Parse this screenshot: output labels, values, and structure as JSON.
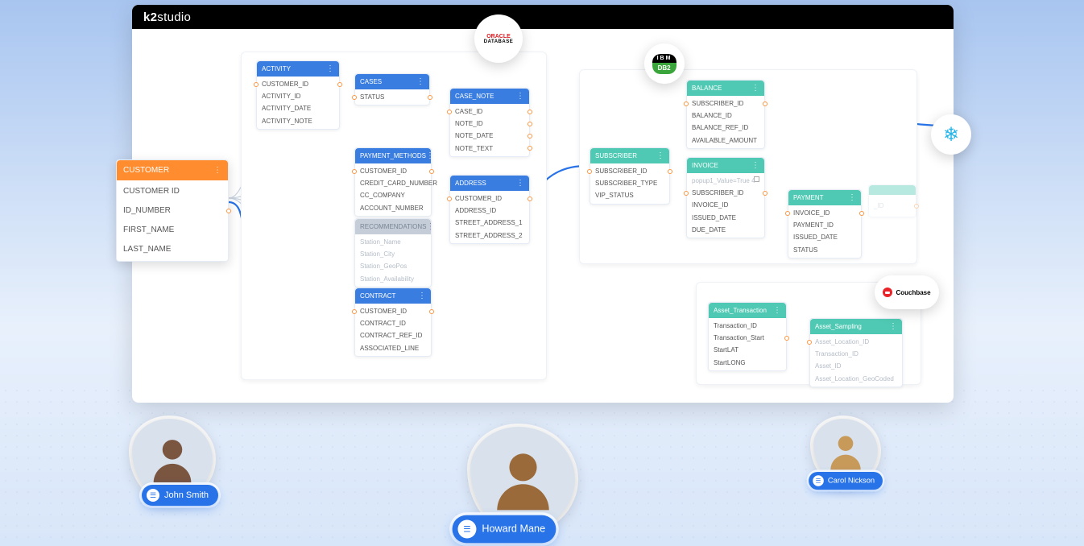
{
  "app": {
    "logo_prefix": "k2",
    "logo_suffix": "studio"
  },
  "badges": {
    "oracle": {
      "line1": "ORACLE",
      "line2": "DATABASE"
    },
    "ibm": {
      "top": "IBM",
      "bottom": "DB2"
    },
    "couchbase": "Couchbase"
  },
  "customer": {
    "title": "CUSTOMER",
    "fields": [
      "CUSTOMER ID",
      "ID_NUMBER",
      "FIRST_NAME",
      "LAST_NAME"
    ]
  },
  "oracle_panel": {
    "activity": {
      "title": "ACTIVITY",
      "fields": [
        "CUSTOMER_ID",
        "ACTIVITY_ID",
        "ACTIVITY_DATE",
        "ACTIVITY_NOTE"
      ]
    },
    "cases": {
      "title": "CASES",
      "fields": [
        "STATUS"
      ]
    },
    "case_note": {
      "title": "CASE_NOTE",
      "fields": [
        "CASE_ID",
        "NOTE_ID",
        "NOTE_DATE",
        "NOTE_TEXT"
      ]
    },
    "payment_methods": {
      "title": "PAYMENT_METHODS",
      "fields": [
        "CUSTOMER_ID",
        "CREDIT_CARD_NUMBER",
        "CC_COMPANY",
        "ACCOUNT_NUMBER"
      ]
    },
    "address": {
      "title": "ADDRESS",
      "fields": [
        "CUSTOMER_ID",
        "ADDRESS_ID",
        "STREET_ADDRESS_1",
        "STREET_ADDRESS_2"
      ]
    },
    "recommendations": {
      "title": "RECOMMENDATIONS",
      "fields": [
        "Station_Name",
        "Station_City",
        "Station_GeoPos",
        "Station_Availability"
      ]
    },
    "contract": {
      "title": "CONTRACT",
      "fields": [
        "CUSTOMER_ID",
        "CONTRACT_ID",
        "CONTRACT_REF_ID",
        "ASSOCIATED_LINE"
      ]
    }
  },
  "db2_panel": {
    "subscriber": {
      "title": "SUBSCRIBER",
      "fields": [
        "SUBSCRIBER_ID",
        "SUBSCRIBER_TYPE",
        "VIP_STATUS"
      ]
    },
    "balance": {
      "title": "BALANCE",
      "fields": [
        "SUBSCRIBER_ID",
        "BALANCE_ID",
        "BALANCE_REF_ID",
        "AVAILABLE_AMOUNT"
      ]
    },
    "invoice": {
      "title": "INVOICE",
      "fields": [
        "popup1_Value=True",
        "SUBSCRIBER_ID",
        "INVOICE_ID",
        "ISSUED_DATE",
        "DUE_DATE"
      ]
    },
    "payment": {
      "title": "PAYMENT",
      "fields": [
        "INVOICE_ID",
        "PAYMENT_ID",
        "ISSUED_DATE",
        "STATUS"
      ]
    },
    "faded": {
      "title": "",
      "fields": [
        "",
        "_ID",
        ""
      ]
    }
  },
  "couchbase_panel": {
    "asset_transaction": {
      "title": "Asset_Transaction",
      "fields": [
        "Transaction_ID",
        "Transaction_Start",
        "StartLAT",
        "StartLONG"
      ]
    },
    "asset_sampling": {
      "title": "Asset_Sampling",
      "fields": [
        "Asset_Location_ID",
        "Transaction_ID",
        "Asset_ID",
        "Asset_Location_GeoCoded"
      ]
    }
  },
  "people": {
    "john": "John Smith",
    "howard": "Howard Mane",
    "carol": "Carol Nickson"
  }
}
